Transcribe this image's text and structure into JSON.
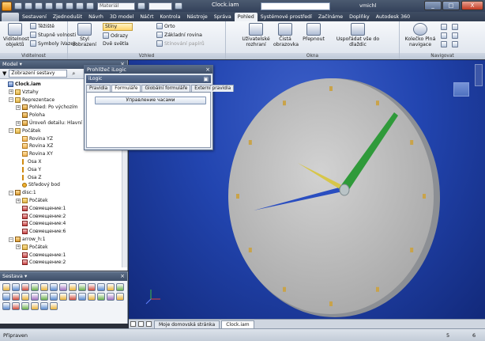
{
  "window": {
    "title": "Clock.iam",
    "material_combo": "Materiál",
    "user": "vmichl",
    "controls": [
      "_",
      "□",
      "X"
    ]
  },
  "ribbon_tabs": [
    "",
    "Sestavení",
    "Zjednodušit",
    "Návrh",
    "3D model",
    "Náčrt",
    "Kontrola",
    "Nástroje",
    "Správa",
    "Pohled",
    "Systémové prostředí",
    "Začínáme",
    "Doplňky",
    "Autodesk 360"
  ],
  "active_tab": "Pohled",
  "ribbon": {
    "viditelnost": {
      "label": "Viditelnost",
      "big_button": "Viditelnost objektů",
      "items": [
        "Těžiště",
        "Stupně volnosti",
        "Symboly iVazeb"
      ]
    },
    "vzhled": {
      "label": "Vzhled",
      "style_button": "Styl zobrazení",
      "stiny": "Stíny",
      "odrazy": "Odrazy",
      "dve_svetla": "Dvě světla",
      "orto": "Orto",
      "zakladni_rovina": "Základní rovina",
      "stiny_papir": "Stínování papírů"
    },
    "okna": {
      "label": "Okna",
      "buttons": [
        "Uživatelské rozhraní",
        "Čistá obrazovka",
        "Přepnout",
        "Uspořádat vše do dlaždic"
      ]
    },
    "navigovat": {
      "label": "Navigovat",
      "wheel": "Kolečko Plná navigace"
    }
  },
  "model_pane": {
    "title": "Model ▾",
    "combo": "Zobrazení sestavy",
    "tree": [
      {
        "text": "Clock.iam",
        "icon": "asm",
        "level": 0,
        "expander": ""
      },
      {
        "text": "Vztahy",
        "icon": "folder",
        "level": 1,
        "expander": "+"
      },
      {
        "text": "Reprezentace",
        "icon": "folder",
        "level": 1,
        "expander": "−"
      },
      {
        "text": "Pohled: Po výchozím",
        "icon": "part",
        "level": 2,
        "expander": "+"
      },
      {
        "text": "Poloha",
        "icon": "part",
        "level": 2,
        "expander": ""
      },
      {
        "text": "Úroveň detailu: Hlavní",
        "icon": "part",
        "level": 2,
        "expander": "+"
      },
      {
        "text": "Počátek",
        "icon": "folder",
        "level": 1,
        "expander": "−"
      },
      {
        "text": "Rovina YZ",
        "icon": "plane",
        "level": 2,
        "expander": ""
      },
      {
        "text": "Rovina XZ",
        "icon": "plane",
        "level": 2,
        "expander": ""
      },
      {
        "text": "Rovina XY",
        "icon": "plane",
        "level": 2,
        "expander": ""
      },
      {
        "text": "Osa X",
        "icon": "axis",
        "level": 2,
        "expander": ""
      },
      {
        "text": "Osa Y",
        "icon": "axis",
        "level": 2,
        "expander": ""
      },
      {
        "text": "Osa Z",
        "icon": "axis",
        "level": 2,
        "expander": ""
      },
      {
        "text": "Středový bod",
        "icon": "pt",
        "level": 2,
        "expander": ""
      },
      {
        "text": "disc:1",
        "icon": "part",
        "level": 1,
        "expander": "−"
      },
      {
        "text": "Počátek",
        "icon": "folder",
        "level": 2,
        "expander": "+"
      },
      {
        "text": "Совмещение:1",
        "icon": "constraint",
        "level": 2,
        "expander": ""
      },
      {
        "text": "Совмещение:2",
        "icon": "constraint",
        "level": 2,
        "expander": ""
      },
      {
        "text": "Совмещение:4",
        "icon": "constraint",
        "level": 2,
        "expander": ""
      },
      {
        "text": "Совмещение:6",
        "icon": "constraint",
        "level": 2,
        "expander": ""
      },
      {
        "text": "arrow_h:1",
        "icon": "part",
        "level": 1,
        "expander": "−"
      },
      {
        "text": "Počátek",
        "icon": "folder",
        "level": 2,
        "expander": "+"
      },
      {
        "text": "Совмещение:1",
        "icon": "constraint",
        "level": 2,
        "expander": ""
      },
      {
        "text": "Совмещение:2",
        "icon": "constraint",
        "level": 2,
        "expander": ""
      }
    ]
  },
  "assembly_pane": {
    "title": "Sestava ▾",
    "tool_colors": [
      "#e9b33a",
      "#5a8ad0",
      "#d04a3a",
      "#6ab04a",
      "#e9b33a",
      "#5a8ad0",
      "#a070c0",
      "#e9b33a",
      "#6ab04a",
      "#d04a3a",
      "#5a8ad0",
      "#e9b33a",
      "#6ab04a",
      "#5a8ad0",
      "#d04a3a",
      "#e9b33a",
      "#a070c0",
      "#6ab04a",
      "#5a8ad0",
      "#e9b33a",
      "#d04a3a",
      "#5a8ad0",
      "#e9b33a",
      "#6ab04a",
      "#a070c0",
      "#e9b33a",
      "#5a8ad0",
      "#d04a3a",
      "#6ab04a",
      "#e9b33a",
      "#5a8ad0",
      "#e9b33a"
    ]
  },
  "ilogic": {
    "window_title": "Prohlížeč iLogic",
    "sub_title": "iLogic",
    "tabs": [
      "Pravidla",
      "Formuláře",
      "Globální formuláře",
      "Externí pravidla"
    ],
    "active_tab": "Formuláře",
    "button": "Управление часами"
  },
  "document_tabs": [
    "Moje domovská stránka",
    "Clock.iam"
  ],
  "active_document": "Clock.iam",
  "status": {
    "left": "Připraven",
    "num1": "5",
    "num2": "6"
  },
  "viewport": {
    "clock_face_color": "#c8c8c8",
    "hour_hand_color": "#d7c64a",
    "minute_hand_color": "#2f9a3a",
    "second_hand_color": "#2a4ec0",
    "marker_color": "#c9a34a"
  }
}
